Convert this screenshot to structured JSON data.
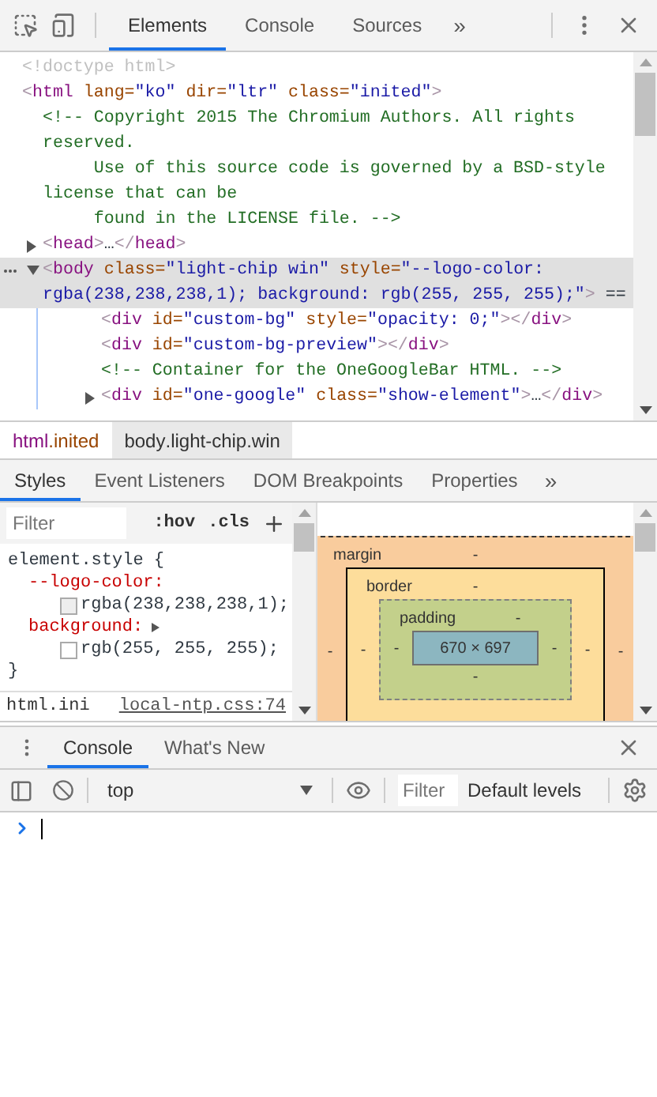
{
  "toolbar": {
    "tabs": [
      {
        "label": "Elements",
        "selected": true
      },
      {
        "label": "Console",
        "selected": false
      },
      {
        "label": "Sources",
        "selected": false
      }
    ],
    "more": "»"
  },
  "dom_tree": [
    {
      "selected": false,
      "tokens": [
        {
          "kind": "doctype",
          "text": "<!doctype html>"
        }
      ]
    },
    {
      "selected": false,
      "tokens": [
        {
          "kind": "bracket",
          "text": "<"
        },
        {
          "kind": "tag",
          "text": "html"
        },
        {
          "kind": "attr",
          "text": " lang="
        },
        {
          "kind": "value",
          "text": "\"ko\""
        },
        {
          "kind": "attr",
          "text": " dir="
        },
        {
          "kind": "value",
          "text": "\"ltr\""
        },
        {
          "kind": "attr",
          "text": " class="
        },
        {
          "kind": "value",
          "text": "\"inited\""
        },
        {
          "kind": "bracket",
          "text": ">"
        }
      ],
      "children": [
        {
          "selected": false,
          "tokens": [
            {
              "kind": "comment",
              "text": "<!-- Copyright 2015 The Chromium Authors. All rights reserved.\n     Use of this source code is governed by a BSD-style license that can be\n     found in the LICENSE file. -->"
            }
          ]
        },
        {
          "selected": false,
          "expanded": false,
          "tokens": [
            {
              "kind": "bracket",
              "text": "<"
            },
            {
              "kind": "tag",
              "text": "head"
            },
            {
              "kind": "bracket",
              "text": ">"
            },
            {
              "kind": "text",
              "text": "…"
            },
            {
              "kind": "bracket",
              "text": "</"
            },
            {
              "kind": "tag",
              "text": "head"
            },
            {
              "kind": "bracket",
              "text": ">"
            }
          ]
        },
        {
          "selected": true,
          "expanded": true,
          "tokens": [
            {
              "kind": "bracket",
              "text": "<"
            },
            {
              "kind": "tag",
              "text": "body"
            },
            {
              "kind": "attr",
              "text": " class="
            },
            {
              "kind": "value",
              "text": "\"light-chip win\""
            },
            {
              "kind": "attr",
              "text": " style="
            },
            {
              "kind": "value",
              "text": "\"--logo-color: rgba(238,238,238,1); background: rgb(255, 255, 255);\""
            },
            {
              "kind": "bracket",
              "text": ">"
            },
            {
              "kind": "text",
              "text": " =="
            }
          ],
          "children": [
            {
              "selected": false,
              "tokens": [
                {
                  "kind": "bracket",
                  "text": "<"
                },
                {
                  "kind": "tag",
                  "text": "div"
                },
                {
                  "kind": "attr",
                  "text": " id="
                },
                {
                  "kind": "value",
                  "text": "\"custom-bg\""
                },
                {
                  "kind": "attr",
                  "text": " style="
                },
                {
                  "kind": "value",
                  "text": "\"opacity: 0;\""
                },
                {
                  "kind": "bracket",
                  "text": "></"
                },
                {
                  "kind": "tag",
                  "text": "div"
                },
                {
                  "kind": "bracket",
                  "text": ">"
                }
              ]
            },
            {
              "selected": false,
              "tokens": [
                {
                  "kind": "bracket",
                  "text": "<"
                },
                {
                  "kind": "tag",
                  "text": "div"
                },
                {
                  "kind": "attr",
                  "text": " id="
                },
                {
                  "kind": "value",
                  "text": "\"custom-bg-preview\""
                },
                {
                  "kind": "bracket",
                  "text": "></"
                },
                {
                  "kind": "tag",
                  "text": "div"
                },
                {
                  "kind": "bracket",
                  "text": ">"
                }
              ]
            },
            {
              "selected": false,
              "tokens": [
                {
                  "kind": "comment",
                  "text": "<!-- Container for the OneGoogleBar HTML. -->"
                }
              ]
            },
            {
              "selected": false,
              "expanded": false,
              "tokens": [
                {
                  "kind": "bracket",
                  "text": "<"
                },
                {
                  "kind": "tag",
                  "text": "div"
                },
                {
                  "kind": "attr",
                  "text": " id="
                },
                {
                  "kind": "value",
                  "text": "\"one-google\""
                },
                {
                  "kind": "attr",
                  "text": " class="
                },
                {
                  "kind": "value",
                  "text": "\"show-element\""
                },
                {
                  "kind": "bracket",
                  "text": ">"
                },
                {
                  "kind": "text",
                  "text": "…"
                },
                {
                  "kind": "bracket",
                  "text": "</"
                },
                {
                  "kind": "tag",
                  "text": "div"
                },
                {
                  "kind": "bracket",
                  "text": ">"
                }
              ]
            }
          ]
        }
      ]
    }
  ],
  "breadcrumbs": [
    {
      "tag": "html",
      "classes": ".inited",
      "selected": false
    },
    {
      "tag": "body",
      "classes": ".light-chip.win",
      "selected": true
    }
  ],
  "styles_tabs": {
    "tabs": [
      {
        "label": "Styles",
        "selected": true
      },
      {
        "label": "Event Listeners",
        "selected": false
      },
      {
        "label": "DOM Breakpoints",
        "selected": false
      },
      {
        "label": "Properties",
        "selected": false
      }
    ],
    "more": "»"
  },
  "styles_toolbar": {
    "filter_placeholder": "Filter",
    "hov": ":hov",
    "cls": ".cls"
  },
  "style_rule": {
    "selector": "element.style {",
    "properties": [
      {
        "name": "--logo-color:",
        "value": "rgba(238,238,238,1);",
        "color": "#eeeeee",
        "expandable": false
      },
      {
        "name": "background:",
        "value": "rgb(255, 255, 255);",
        "color": "#ffffff",
        "expandable": true
      }
    ],
    "close": "}"
  },
  "next_rule": {
    "selector": "html.ini",
    "source": "local-ntp.css:74"
  },
  "box_model": {
    "margin": {
      "label": "margin",
      "top": "-",
      "left": "-",
      "right": "-"
    },
    "border": {
      "label": "border",
      "top": "-",
      "left": "-",
      "right": "-"
    },
    "padding": {
      "label": "padding",
      "top": "-",
      "left": "-",
      "right": "-",
      "bottom": "-"
    },
    "content": "670 × 697"
  },
  "drawer": {
    "tabs": [
      {
        "label": "Console",
        "selected": true
      },
      {
        "label": "What's New",
        "selected": false
      }
    ]
  },
  "console_toolbar": {
    "context": "top",
    "filter_placeholder": "Filter",
    "levels": "Default levels"
  }
}
